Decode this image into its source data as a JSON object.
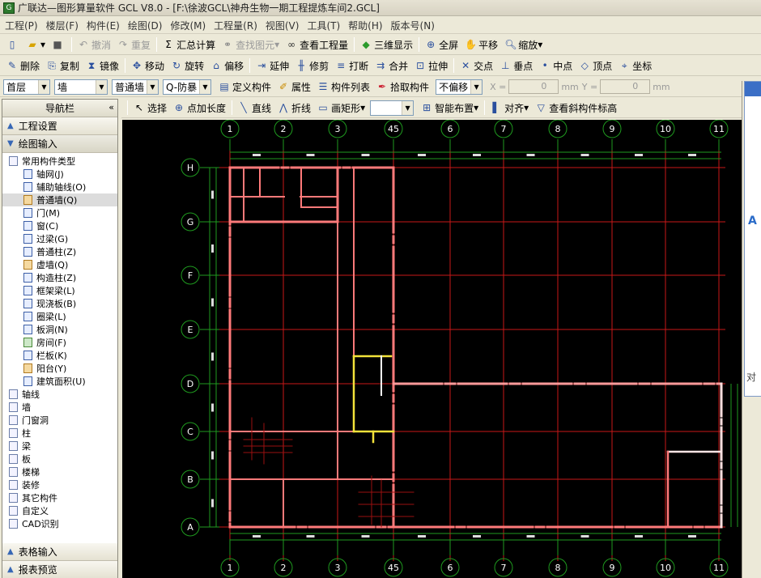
{
  "window": {
    "title": "广联达—图形算量软件 GCL V8.0 - [F:\\徐波GCL\\神舟生物一期工程提炼车间2.GCL]"
  },
  "menu": [
    "工程(P)",
    "楼层(F)",
    "构件(E)",
    "绘图(D)",
    "修改(M)",
    "工程量(R)",
    "视图(V)",
    "工具(T)",
    "帮助(H)",
    "版本号(N)"
  ],
  "toolbar1": {
    "undo": "撤消",
    "redo": "重复",
    "sum": "汇总计算",
    "find": "查找图元",
    "view_qty": "查看工程量",
    "three_d": "三维显示",
    "fullscreen": "全屏",
    "pan": "平移",
    "zoom": "缩放"
  },
  "toolbar2": {
    "delete": "删除",
    "copy": "复制",
    "mirror": "镜像",
    "move": "移动",
    "rotate": "旋转",
    "offset": "偏移",
    "extend": "延伸",
    "trim": "修剪",
    "break": "打断",
    "merge": "合并",
    "stretch": "拉伸",
    "intersect": "交点",
    "perp": "垂点",
    "mid": "中点",
    "vertex": "顶点",
    "coord": "坐标"
  },
  "toolbar3": {
    "floor": "首层",
    "type": "墙",
    "subtype": "普通墙",
    "member": "Q-防暴",
    "define": "定义构件",
    "props": "属性",
    "list": "构件列表",
    "pick": "拾取构件",
    "offset_mode": "不偏移",
    "x_label": "X =",
    "x_val": "0",
    "x_unit": "mm",
    "y_label": "Y =",
    "y_val": "0",
    "y_unit": "mm"
  },
  "toolbar4": {
    "select": "选择",
    "point_len": "点加长度",
    "line": "直线",
    "polyline": "折线",
    "rect": "画矩形",
    "smart": "智能布置",
    "align": "对齐",
    "view_slope": "查看斜构件标高"
  },
  "nav": {
    "title": "导航栏",
    "sec_project": "工程设置",
    "sec_draw": "绘图输入",
    "group_common": "常用构件类型",
    "children": [
      "轴网(J)",
      "辅助轴线(O)",
      "普通墙(Q)",
      "门(M)",
      "窗(C)",
      "过梁(G)",
      "普通柱(Z)",
      "虚墙(Q)",
      "构造柱(Z)",
      "框架梁(L)",
      "现浇板(B)",
      "圈梁(L)",
      "板洞(N)",
      "房间(F)",
      "栏板(K)",
      "阳台(Y)",
      "建筑面积(U)"
    ],
    "groups": [
      "轴线",
      "墙",
      "门窗洞",
      "柱",
      "梁",
      "板",
      "楼梯",
      "装修",
      "其它构件",
      "自定义",
      "CAD识别"
    ],
    "sec_table": "表格输入",
    "sec_report": "报表预览"
  },
  "canvas": {
    "axis_x": [
      "1",
      "2",
      "3",
      "45",
      "6",
      "7",
      "8",
      "9",
      "10",
      "11"
    ],
    "axis_y": [
      "H",
      "G",
      "F",
      "E",
      "D",
      "C",
      "B",
      "A"
    ]
  },
  "right_panel": {
    "text": "对"
  }
}
